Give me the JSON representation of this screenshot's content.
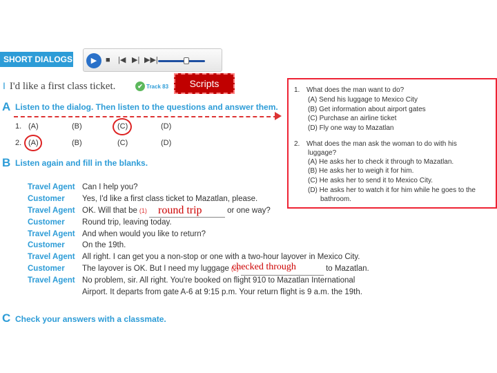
{
  "header": {
    "banner": "SHORT DIALOGS",
    "section_num": "I",
    "title": "I'd like a first class ticket.",
    "track_label": "Track 83"
  },
  "player": {
    "play_icon": "play-icon",
    "controls": [
      "■",
      "|◀",
      "▶|",
      "▶▶|"
    ],
    "volume_fraction": 0.6
  },
  "scripts_button": "Scripts",
  "section_a": {
    "letter": "A",
    "instruction": "Listen to the dialog. Then listen to the questions and answer them.",
    "rows": [
      {
        "num": "1.",
        "options": [
          "(A)",
          "(B)",
          "(C)",
          "(D)"
        ],
        "circled_index": 2
      },
      {
        "num": "2.",
        "options": [
          "(A)",
          "(B)",
          "(C)",
          "(D)"
        ],
        "circled_index": 0
      }
    ]
  },
  "section_b": {
    "letter": "B",
    "instruction": "Listen again and fill in the blanks."
  },
  "dialog": [
    {
      "speaker": "Travel Agent",
      "text": "Can I help you?"
    },
    {
      "speaker": "Customer",
      "text": "Yes, I'd like a first class ticket to Mazatlan, please."
    },
    {
      "speaker": "Travel Agent",
      "before": "OK. Will that be",
      "blank_label": "(1)",
      "after": "or one way?"
    },
    {
      "speaker": "Customer",
      "text": "Round trip, leaving today."
    },
    {
      "speaker": "Travel Agent",
      "text": "And when would you like to return?"
    },
    {
      "speaker": "Customer",
      "text": "On the 19th."
    },
    {
      "speaker": "Travel Agent",
      "text": "All right. I can get you a non-stop or one with a two-hour layover in Mexico City."
    },
    {
      "speaker": "Customer",
      "before": "The layover is OK. But I need my luggage",
      "blank_label": "(2)",
      "after": "to Mazatlan."
    },
    {
      "speaker": "Travel Agent",
      "text": "No problem, sir. All right. You're booked on flight 910 to Mazatlan International"
    },
    {
      "speaker": "",
      "text": "Airport. It departs from gate A-6 at 9:15 p.m. Your return flight is 9 a.m. the 19th."
    }
  ],
  "answers": {
    "blank1": "round trip",
    "blank2": "checked through"
  },
  "section_c": {
    "letter": "C",
    "instruction": "Check your answers with a classmate."
  },
  "questions": [
    {
      "num": "1.",
      "text": "What does the man want to do?",
      "choices": [
        "(A) Send his luggage to Mexico City",
        "(B) Get information about airport gates",
        "(C) Purchase an airline ticket",
        "(D) Fly one way to Mazatlan"
      ]
    },
    {
      "num": "2.",
      "text": "What does the man ask the woman to do with his",
      "text2": "luggage?",
      "choices": [
        "(A) He asks her to check it through to Mazatlan.",
        "(B) He asks her to weigh it for him.",
        "(C) He asks her to send it to Mexico City.",
        "(D) He asks her to watch it for him while he goes to the"
      ],
      "choice_cont": "bathroom."
    }
  ],
  "colors": {
    "accent_blue": "#2d9cd7",
    "red": "#d33",
    "scripts_bg": "#c00000"
  }
}
